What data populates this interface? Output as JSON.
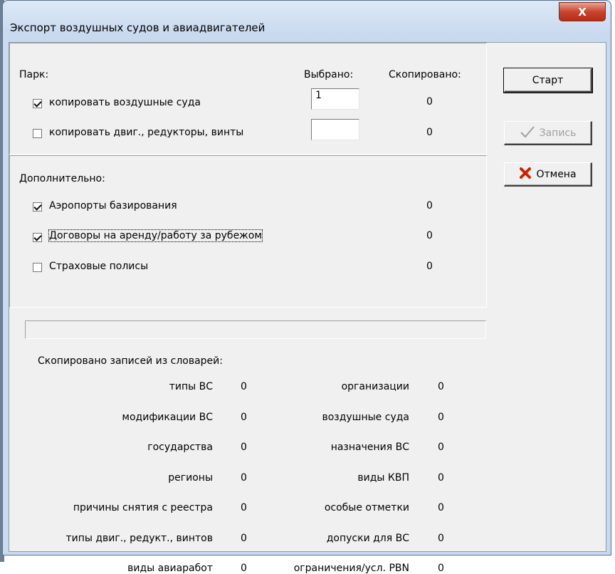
{
  "window": {
    "title": "Экспорт воздушных судов и авиадвигателей",
    "close_label": "X"
  },
  "park": {
    "label": "Парк:",
    "header_selected": "Выбрано:",
    "header_copied": "Скопировано:",
    "rows": [
      {
        "label": "копировать воздушные суда",
        "checked": true,
        "selected": "1",
        "copied": "0"
      },
      {
        "label": "копировать двиг., редукторы, винты",
        "checked": false,
        "selected": "",
        "copied": "0"
      }
    ]
  },
  "extra": {
    "label": "Дополнительно:",
    "rows": [
      {
        "label": "Аэропорты базирования",
        "checked": true,
        "copied": "0"
      },
      {
        "label": "Договоры на аренду/работу за рубежом",
        "checked": true,
        "copied": "0"
      },
      {
        "label": "Страховые полисы",
        "checked": false,
        "copied": "0"
      }
    ]
  },
  "progress": {
    "value": 0
  },
  "dictionaries": {
    "label": "Скопировано записей из словарей:",
    "left": [
      {
        "name": "типы ВС",
        "count": "0"
      },
      {
        "name": "модификации ВС",
        "count": "0"
      },
      {
        "name": "государства",
        "count": "0"
      },
      {
        "name": "регионы",
        "count": "0"
      },
      {
        "name": "причины снятия с реестра",
        "count": "0"
      },
      {
        "name": "типы двиг., редукт., винтов",
        "count": "0"
      },
      {
        "name": "виды авиаработ",
        "count": "0"
      }
    ],
    "right": [
      {
        "name": "организации",
        "count": "0"
      },
      {
        "name": "воздушные суда",
        "count": "0"
      },
      {
        "name": "назначения ВС",
        "count": "0"
      },
      {
        "name": "виды КВП",
        "count": "0"
      },
      {
        "name": "особые отметки",
        "count": "0"
      },
      {
        "name": "допуски для ВС",
        "count": "0"
      },
      {
        "name": "ограничения/усл. PBN",
        "count": "0"
      }
    ]
  },
  "buttons": {
    "start": "Старт",
    "save": "Запись",
    "save_icon": "checkmark-icon",
    "cancel": "Отмена",
    "cancel_icon": "red-x-icon",
    "cancel_icon_color": "#cc2200"
  }
}
